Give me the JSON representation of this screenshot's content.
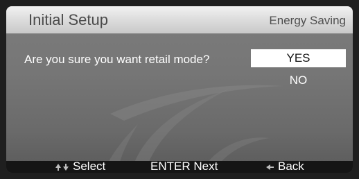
{
  "header": {
    "title": "Initial Setup",
    "section": "Energy Saving"
  },
  "dialog": {
    "question": "Are you sure you want retail mode?",
    "options": [
      {
        "label": "YES",
        "selected": true
      },
      {
        "label": "NO",
        "selected": false
      }
    ]
  },
  "footer": {
    "select_label": "Select",
    "enter_label": "ENTER",
    "next_label": "Next",
    "back_label": "Back"
  },
  "icons": {
    "select": "up-down-arrows-icon",
    "back": "left-arrow-icon"
  },
  "colors": {
    "panel": "#767676",
    "header": "#dedede",
    "footer": "#151515",
    "highlight": "#ffffff"
  }
}
